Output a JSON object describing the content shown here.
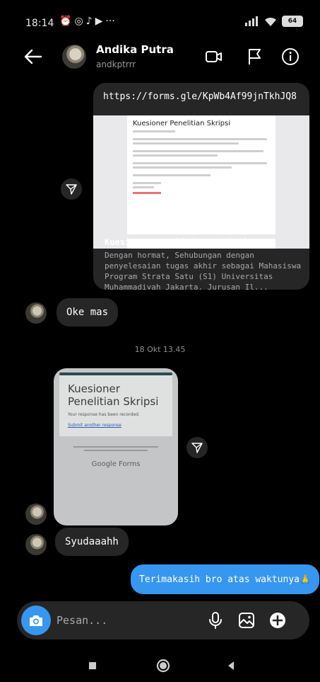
{
  "status": {
    "time": "18:14",
    "left_icons": [
      "alarm-icon",
      "whatsapp-icon",
      "tiktok-icon",
      "play-icon",
      "more-icon"
    ],
    "battery": "64"
  },
  "header": {
    "name": "Andika Putra",
    "username": "andkptrrr"
  },
  "messages": {
    "link_card": {
      "url": "https://forms.gle/KpWb4Af99jnTkhJQ8",
      "preview_heading": "Kuesioner Penelitian Skripsi",
      "title": "Kuesioner Penelitian Skripsi",
      "description": "Dengan hormat, Sehubungan dengan penyelesaian tugas akhir sebagai Mahasiswa Program Strata Satu (S1) Universitas Muhammadiyah Jakarta, Jurusan Il..."
    },
    "reply_1": "Oke mas",
    "timestamp": "18 Okt 13.45",
    "photo": {
      "title": "Kuesioner Penelitian Skripsi",
      "recorded": "Your response has been recorded.",
      "link": "Submit another response",
      "brand": "Google Forms"
    },
    "reply_2": "Syudaaahh",
    "sent_1": "Terimakasih bro atas waktunya🙏"
  },
  "composer": {
    "placeholder": "Pesan..."
  }
}
